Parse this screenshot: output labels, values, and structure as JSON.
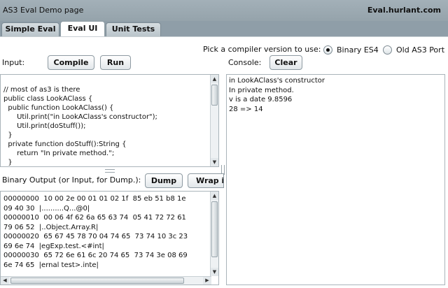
{
  "header": {
    "title": "AS3 Eval Demo page",
    "site": "Eval.hurlant.com"
  },
  "tabs": [
    {
      "label": "Simple Eval",
      "active": false
    },
    {
      "label": "Eval UI",
      "active": true
    },
    {
      "label": "Unit Tests",
      "active": false
    }
  ],
  "compiler": {
    "prompt": "Pick a compiler version to use:",
    "options": [
      {
        "label": "Binary ES4",
        "selected": true
      },
      {
        "label": "Old AS3 Port",
        "selected": false
      }
    ]
  },
  "input": {
    "label": "Input:",
    "compile_label": "Compile",
    "run_label": "Run",
    "code": "// most of as3 is there\npublic class LookAClass {\n  public function LookAClass() {\n      Util.print(\"in LookAClass's constructor\");\n      Util.print(doStuff());\n  }\n  private function doStuff():String {\n      return \"In private method.\";\n  }"
  },
  "console": {
    "label": "Console:",
    "clear_label": "Clear",
    "text": "in LookAClass's constructor\nIn private method.\nv is a date 9.8596\n28 => 14"
  },
  "binary": {
    "label": "Binary Output (or Input, for Dump.):",
    "dump_label": "Dump",
    "wrap_label": "Wrap i",
    "text": "00000000  10 00 2e 00 01 01 02 1f  85 eb 51 b8 1e\n09 40 30  |..........Q...@0|\n00000010  00 06 4f 62 6a 65 63 74  05 41 72 72 61\n79 06 52  |..Object.Array.R|\n00000020  65 67 45 78 70 04 74 65  73 74 10 3c 23\n69 6e 74  |egExp.test.<#int|\n00000030  65 72 6e 61 6c 20 74 65  73 74 3e 08 69\n6e 74 65  |ernal test>.inte|"
  },
  "colors": {
    "chrome": "#8f9ea8",
    "panel": "#ffffff",
    "border": "#aab4ba"
  }
}
